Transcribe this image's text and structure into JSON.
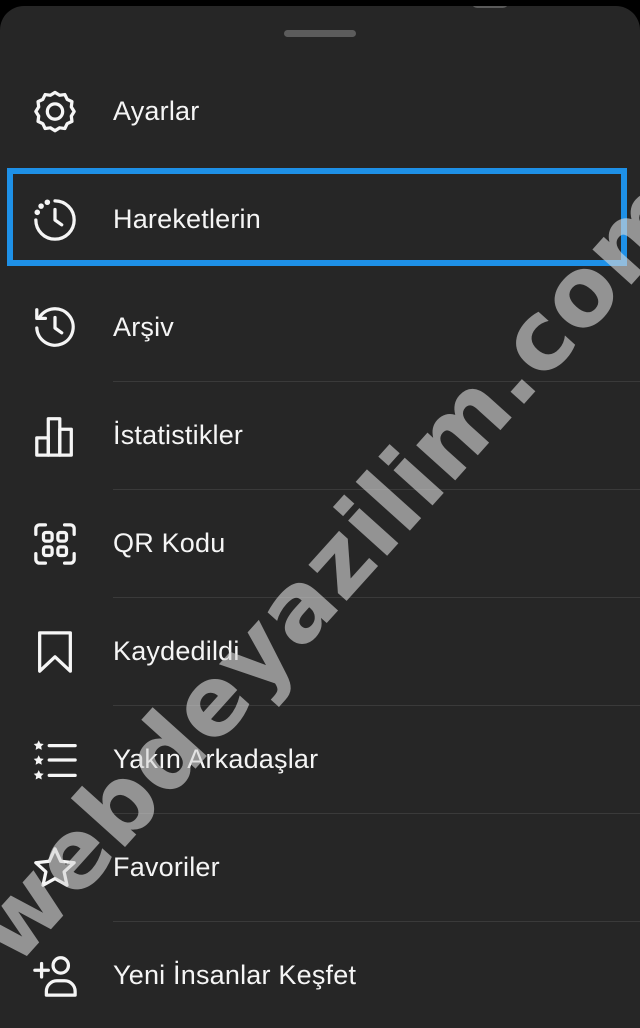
{
  "menu": {
    "items": [
      {
        "label": "Ayarlar",
        "icon": "gear-icon"
      },
      {
        "label": "Hareketlerin",
        "icon": "activity-clock-icon"
      },
      {
        "label": "Arşiv",
        "icon": "archive-history-icon"
      },
      {
        "label": "İstatistikler",
        "icon": "bar-chart-icon"
      },
      {
        "label": "QR Kodu",
        "icon": "qr-scan-icon"
      },
      {
        "label": "Kaydedildi",
        "icon": "bookmark-icon"
      },
      {
        "label": "Yakın Arkadaşlar",
        "icon": "close-friends-list-icon"
      },
      {
        "label": "Favoriler",
        "icon": "star-icon"
      },
      {
        "label": "Yeni İnsanlar Keşfet",
        "icon": "add-person-icon"
      }
    ],
    "highlighted_index": 1
  },
  "watermark": "webdeyazilim.com",
  "colors": {
    "sheet_background": "#262626",
    "text": "#f5f5f5",
    "highlight": "#1e90e6"
  }
}
